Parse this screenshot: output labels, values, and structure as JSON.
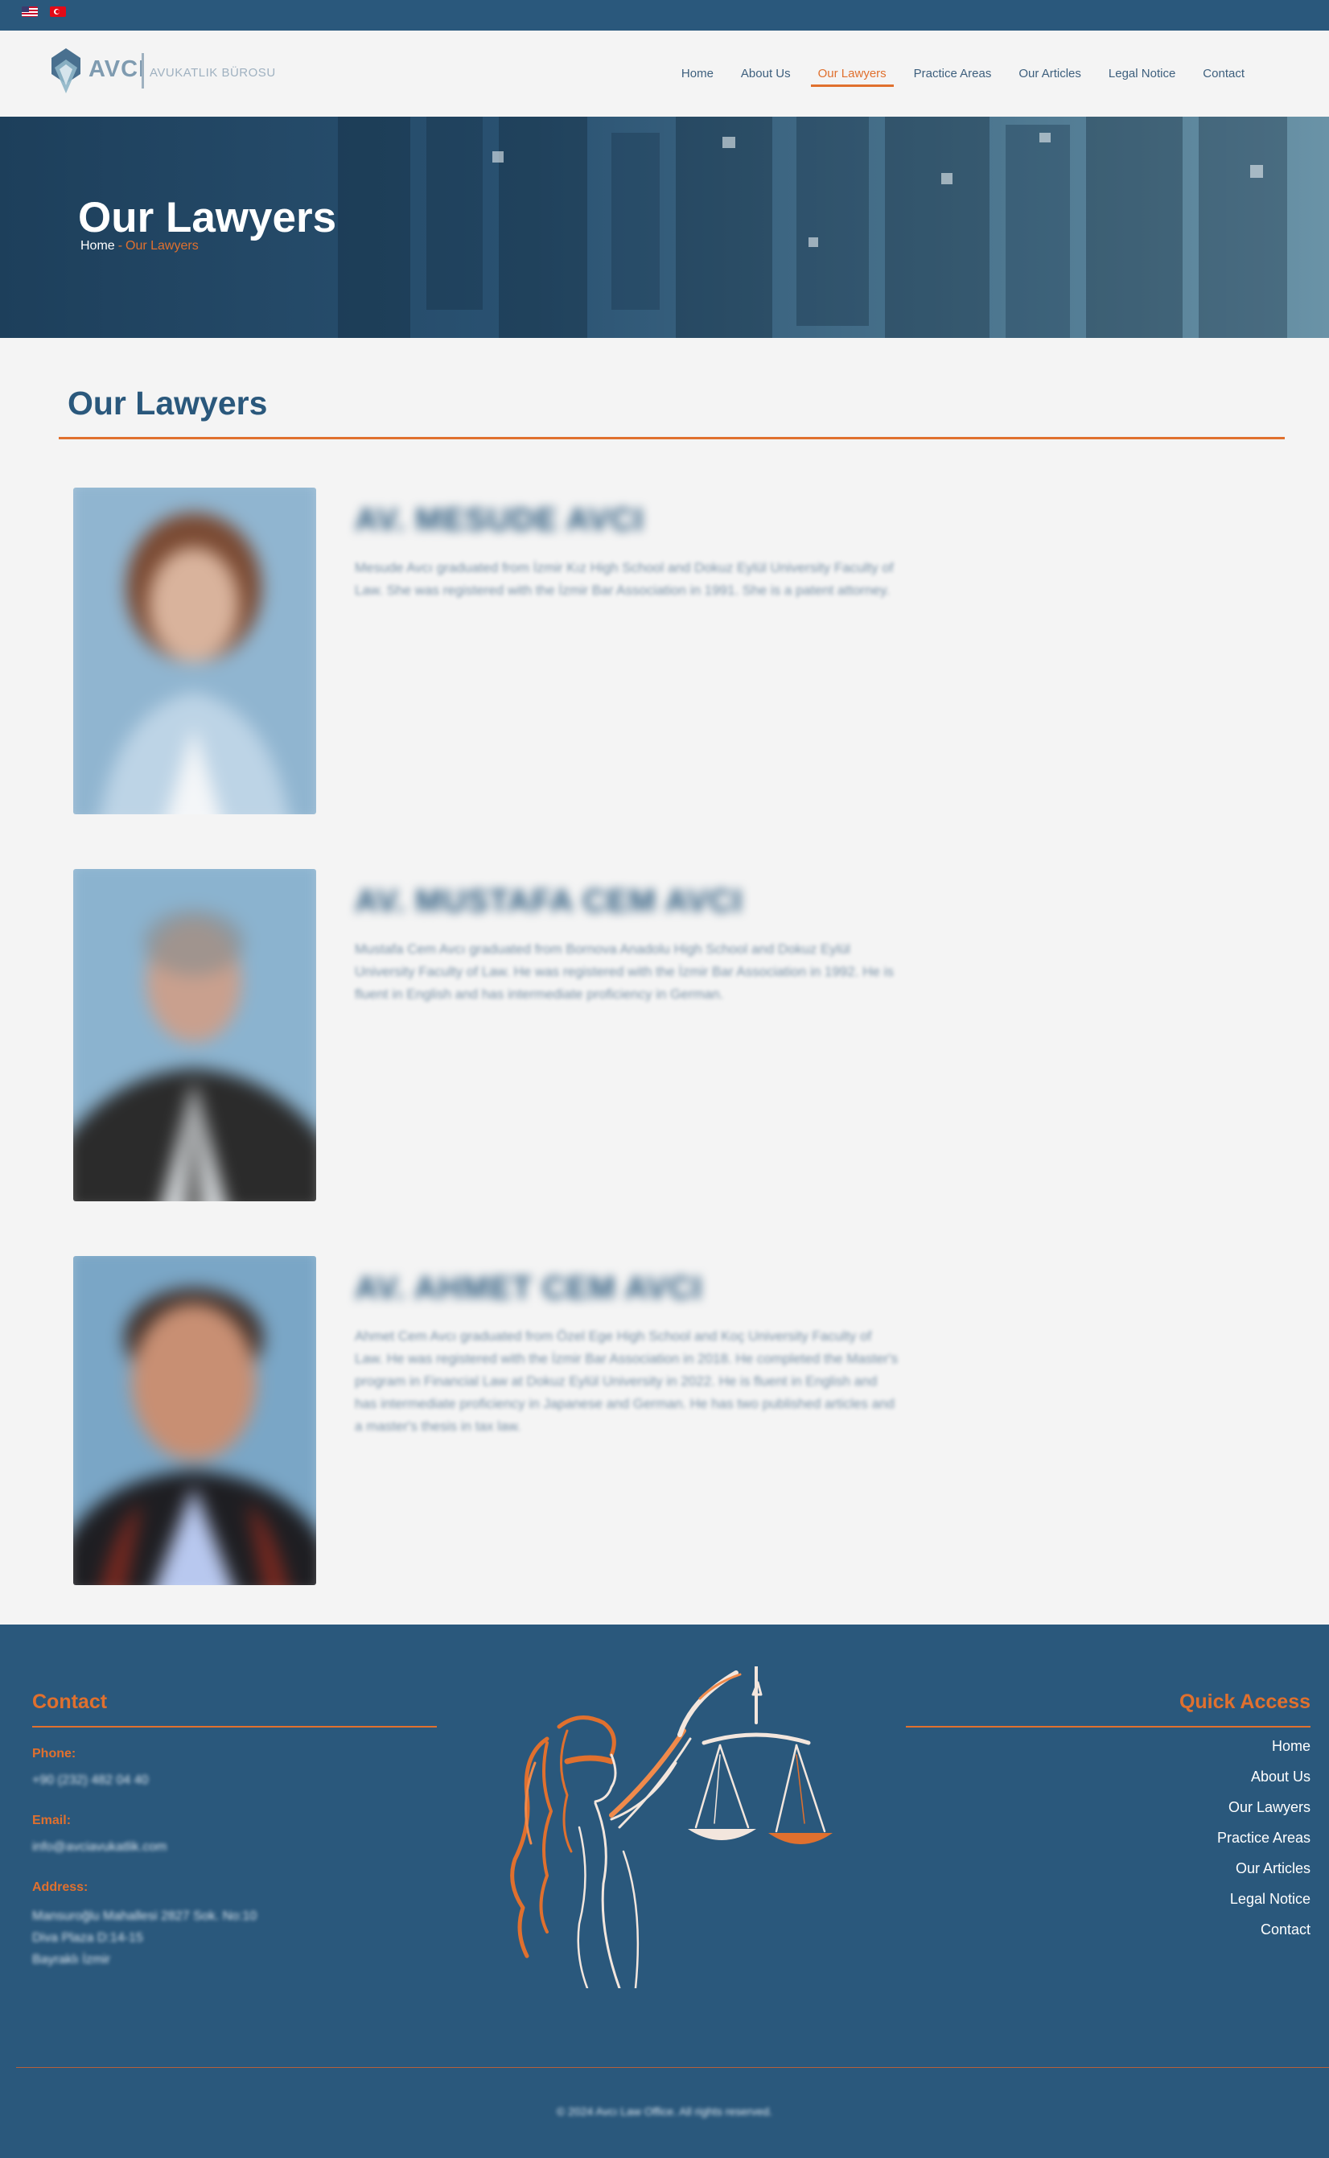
{
  "topbar": {
    "flags": [
      "us-flag-icon",
      "tr-flag-icon"
    ]
  },
  "header": {
    "logo_word": "AVCI",
    "logo_sub": "AVUKATLIK BÜROSU",
    "nav": [
      {
        "label": "Home",
        "active": false
      },
      {
        "label": "About Us",
        "active": false
      },
      {
        "label": "Our Lawyers",
        "active": true
      },
      {
        "label": "Practice Areas",
        "active": false
      },
      {
        "label": "Our Articles",
        "active": false
      },
      {
        "label": "Legal Notice",
        "active": false
      },
      {
        "label": "Contact",
        "active": false
      }
    ]
  },
  "hero": {
    "title": "Our Lawyers",
    "breadcrumb": {
      "home": "Home",
      "separator": "-",
      "current": "Our Lawyers"
    }
  },
  "section": {
    "title": "Our Lawyers"
  },
  "lawyers": [
    {
      "name": "AV. MESUDE AVCI",
      "bio": "Mesude Avcı graduated from İzmir Kız High School and Dokuz Eylül University Faculty of Law. She was registered with the İzmir Bar Association in 1991. She is a patent attorney."
    },
    {
      "name": "AV. MUSTAFA CEM AVCI",
      "bio": "Mustafa Cem Avcı graduated from Bornova Anadolu High School and Dokuz Eylül University Faculty of Law. He was registered with the İzmir Bar Association in 1992. He is fluent in English and has intermediate proficiency in German."
    },
    {
      "name": "AV. AHMET CEM AVCI",
      "bio": "Ahmet Cem Avcı graduated from Özel Ege High School and Koç University Faculty of Law. He was registered with the İzmir Bar Association in 2018. He completed the Master's program in Financial Law at Dokuz Eylül University in 2022. He is fluent in English and has intermediate proficiency in Japanese and German. He has two published articles and a master's thesis in tax law."
    }
  ],
  "footer": {
    "contact": {
      "heading": "Contact",
      "phone_label": "Phone:",
      "phone": "+90 (232) 482 04 40",
      "email_label": "Email:",
      "email": "info@avciavukatlik.com",
      "address_label": "Address:",
      "address_lines": [
        "Mansuroğlu Mahallesi 2827 Sok. No:10",
        "Diva Plaza D:14-15",
        "Bayraklı İzmir"
      ]
    },
    "quick": {
      "heading": "Quick Access",
      "links": [
        "Home",
        "About Us",
        "Our Lawyers",
        "Practice Areas",
        "Our Articles",
        "Legal Notice",
        "Contact"
      ]
    },
    "copyright": "© 2024 Avcı Law Office. All rights reserved."
  },
  "colors": {
    "primary": "#2a587c",
    "accent": "#e0702e",
    "background": "#f4f4f4"
  }
}
